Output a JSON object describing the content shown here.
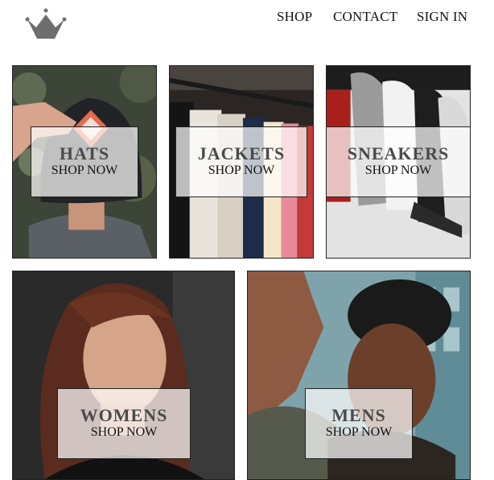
{
  "header": {
    "logo": "crown-icon",
    "nav": [
      {
        "label": "SHOP"
      },
      {
        "label": "CONTACT"
      },
      {
        "label": "SIGN IN"
      }
    ]
  },
  "categories": [
    {
      "title": "HATS",
      "action": "SHOP NOW"
    },
    {
      "title": "JACKETS",
      "action": "SHOP NOW"
    },
    {
      "title": "SNEAKERS",
      "action": "SHOP NOW"
    },
    {
      "title": "WOMENS",
      "action": "SHOP NOW"
    },
    {
      "title": "MENS",
      "action": "SHOP NOW"
    }
  ],
  "colors": {
    "crown": "#6e6e6e",
    "text": "#111111",
    "title": "#4a4a4a"
  }
}
